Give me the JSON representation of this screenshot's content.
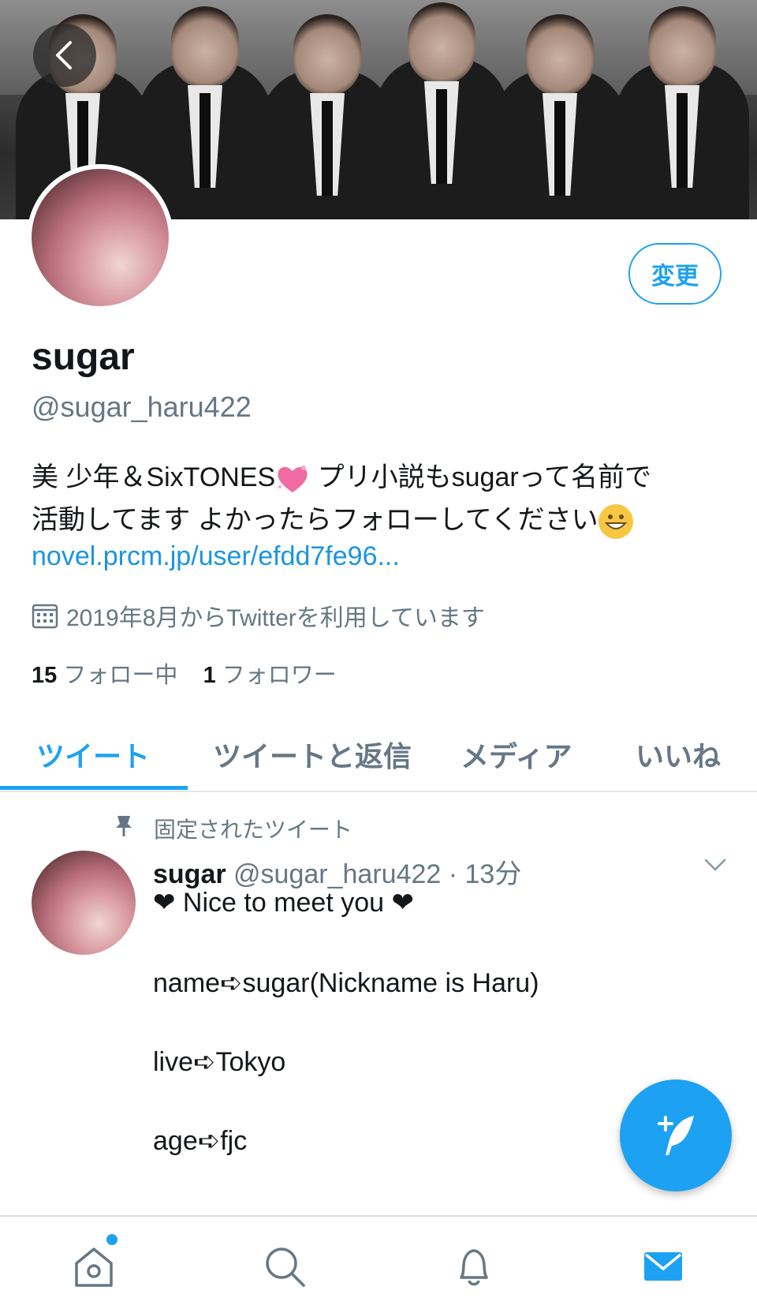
{
  "profile": {
    "name": "sugar",
    "handle": "@sugar_haru422",
    "edit_button": "変更",
    "bio_line1_a": "美 少年＆SixTONES",
    "bio_line1_b": " プリ小説もsugarって名前で",
    "bio_line2": "活動してます よかったらフォローしてください",
    "link": "novel.prcm.jp/user/efdd7fe96...",
    "joined": "2019年8月からTwitterを利用しています",
    "following_count": "15",
    "following_label": "フォロー中",
    "followers_count": "1",
    "followers_label": "フォロワー"
  },
  "tabs": [
    {
      "label": "ツイート",
      "active": true
    },
    {
      "label": "ツイートと返信",
      "active": false
    },
    {
      "label": "メディア",
      "active": false
    },
    {
      "label": "いいね",
      "active": false
    }
  ],
  "tweet": {
    "pinned_label": "固定されたツイート",
    "author": "sugar",
    "handle_time": "@sugar_haru422 · 13分",
    "lines": [
      "❤ Nice to meet you ❤",
      "name➪sugar(Nickname is Haru)",
      "live➪Tokyo",
      "age➪fjc"
    ]
  },
  "icons": {
    "back": "back-arrow-icon",
    "calendar": "calendar-icon",
    "pin": "pin-icon",
    "chevron": "chevron-down-icon",
    "compose": "compose-tweet-icon",
    "home": "home-icon",
    "search": "search-icon",
    "notifications": "bell-icon",
    "messages": "mail-icon"
  },
  "colors": {
    "accent": "#1da1f2",
    "link": "#1b95e0",
    "secondary_text": "#657786"
  }
}
